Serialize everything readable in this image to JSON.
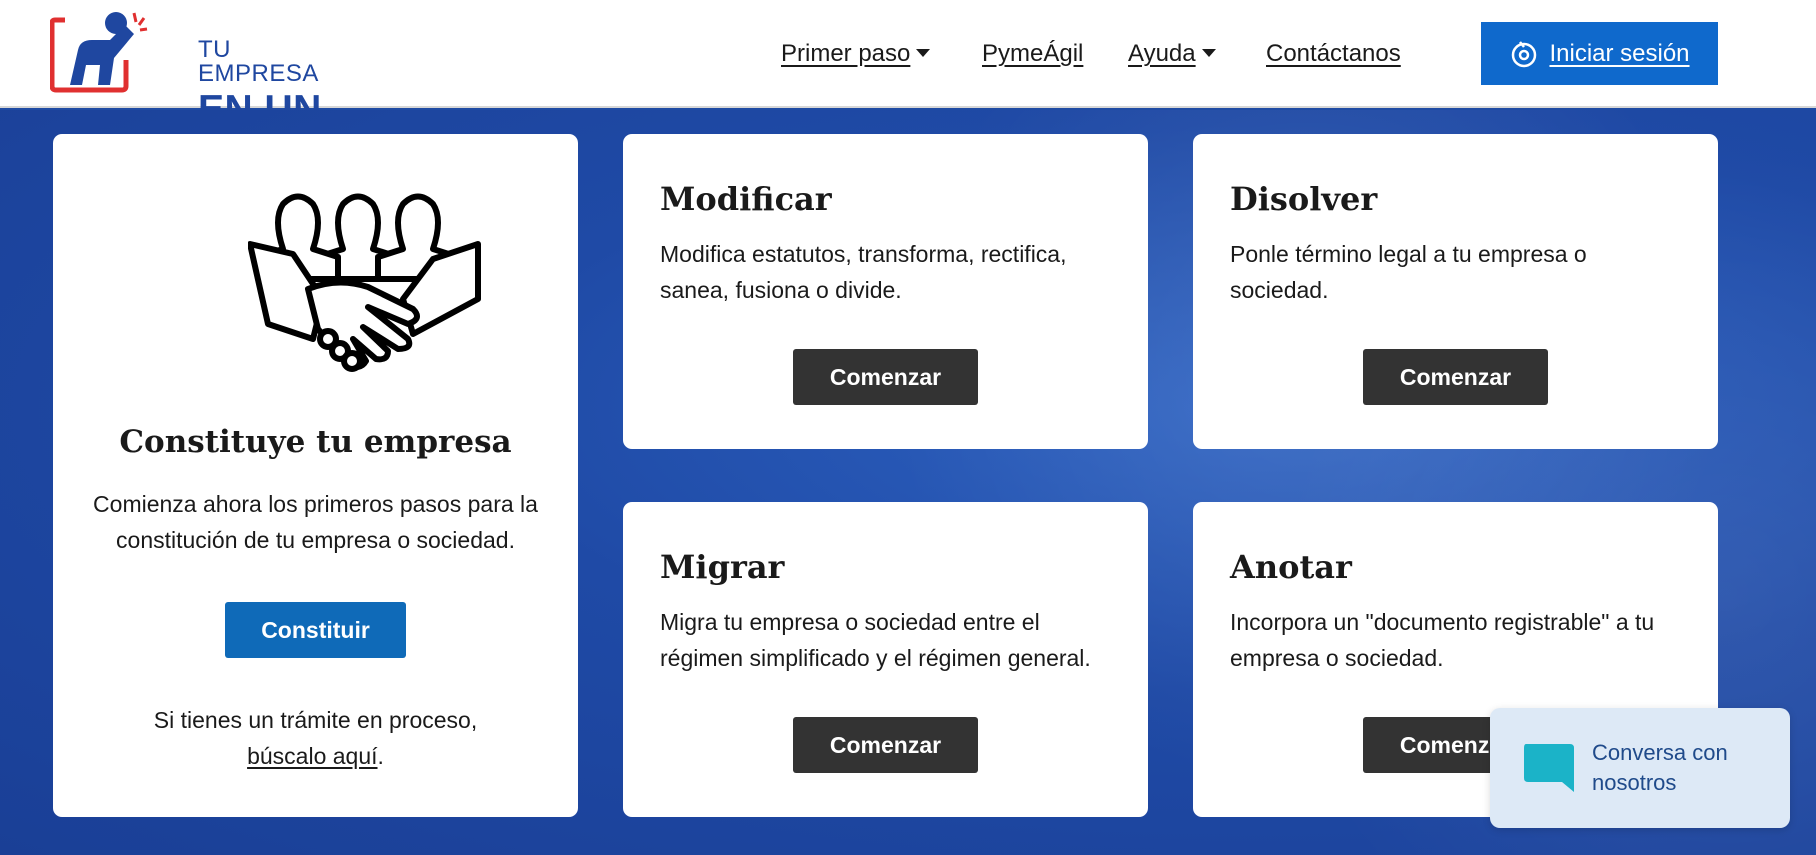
{
  "header": {
    "logo_line1": "TU EMPRESA",
    "logo_line2": "EN UN DÍA",
    "nav": {
      "primer_paso": "Primer paso",
      "pymeagil": "PymeÁgil",
      "ayuda": "Ayuda",
      "contactanos": "Contáctanos"
    },
    "login_label": "Iniciar sesión"
  },
  "main_card": {
    "title": "Constituye tu empresa",
    "description": "Comienza ahora los primeros pasos para la constitución de tu empresa o sociedad.",
    "button_label": "Constituir",
    "process_text": "Si tienes un trámite en proceso,",
    "process_link": "búscalo aquí",
    "process_suffix": "."
  },
  "cards": [
    {
      "title": "Modificar",
      "description": "Modifica estatutos, transforma, rectifica, sanea, fusiona o divide.",
      "button_label": "Comenzar"
    },
    {
      "title": "Disolver",
      "description": "Ponle término legal a tu empresa o sociedad.",
      "button_label": "Comenzar"
    },
    {
      "title": "Migrar",
      "description": "Migra tu empresa o sociedad entre el régimen simplificado y el régimen general.",
      "button_label": "Comenzar"
    },
    {
      "title": "Anotar",
      "description": "Incorpora un \"documento registrable\" a tu empresa o sociedad.",
      "button_label": "Comenzar"
    }
  ],
  "chat": {
    "line1": "Conversa con",
    "line2": "nosotros"
  },
  "colors": {
    "brand_blue": "#1f47a0",
    "login_blue": "#0f69cc",
    "constituir_blue": "#0f6ab8",
    "dark_button": "#333333",
    "logo_red": "#e03030",
    "chat_icon": "#1bb3c8"
  },
  "icons": {
    "logo": "person-raising-arm-logo",
    "login": "power-icon",
    "main_illustration": "handshake-people-icon",
    "chat": "chat-bubble-icon"
  }
}
